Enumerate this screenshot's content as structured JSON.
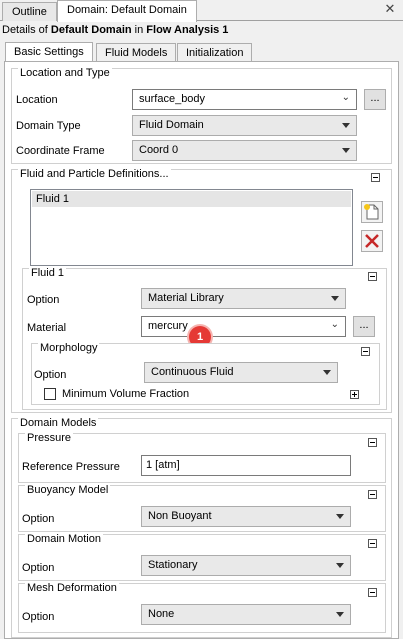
{
  "top_tabs": [
    "Outline",
    "Domain: Default Domain"
  ],
  "details": {
    "prefix": "Details of ",
    "object": "Default Domain",
    "middle": " in ",
    "analysis": "Flow Analysis 1"
  },
  "inner_tabs": [
    "Basic Settings",
    "Fluid Models",
    "Initialization"
  ],
  "location_and_type": {
    "title": "Location and Type",
    "location_label": "Location",
    "location_value": "surface_body",
    "domain_type_label": "Domain Type",
    "domain_type_value": "Fluid Domain",
    "coord_frame_label": "Coordinate Frame",
    "coord_frame_value": "Coord 0"
  },
  "fluid_defs": {
    "title": "Fluid and Particle Definitions...",
    "items": [
      "Fluid 1"
    ]
  },
  "fluid1": {
    "title": "Fluid 1",
    "option_label": "Option",
    "option_value": "Material Library",
    "material_label": "Material",
    "material_value": "mercury",
    "marker": "1",
    "morphology": {
      "title": "Morphology",
      "option_label": "Option",
      "option_value": "Continuous Fluid",
      "min_volume_fraction_label": "Minimum Volume Fraction"
    }
  },
  "domain_models": {
    "title": "Domain Models",
    "pressure": {
      "title": "Pressure",
      "ref_label": "Reference Pressure",
      "ref_value": "1 [atm]"
    },
    "buoyancy": {
      "title": "Buoyancy Model",
      "option_label": "Option",
      "option_value": "Non Buoyant"
    },
    "motion": {
      "title": "Domain Motion",
      "option_label": "Option",
      "option_value": "Stationary"
    },
    "mesh_deformation": {
      "title": "Mesh Deformation",
      "option_label": "Option",
      "option_value": "None"
    }
  },
  "buttons": {
    "ellipsis": "..."
  },
  "colors": {
    "badge": "#e53935",
    "delete_icon": "#c62828"
  }
}
